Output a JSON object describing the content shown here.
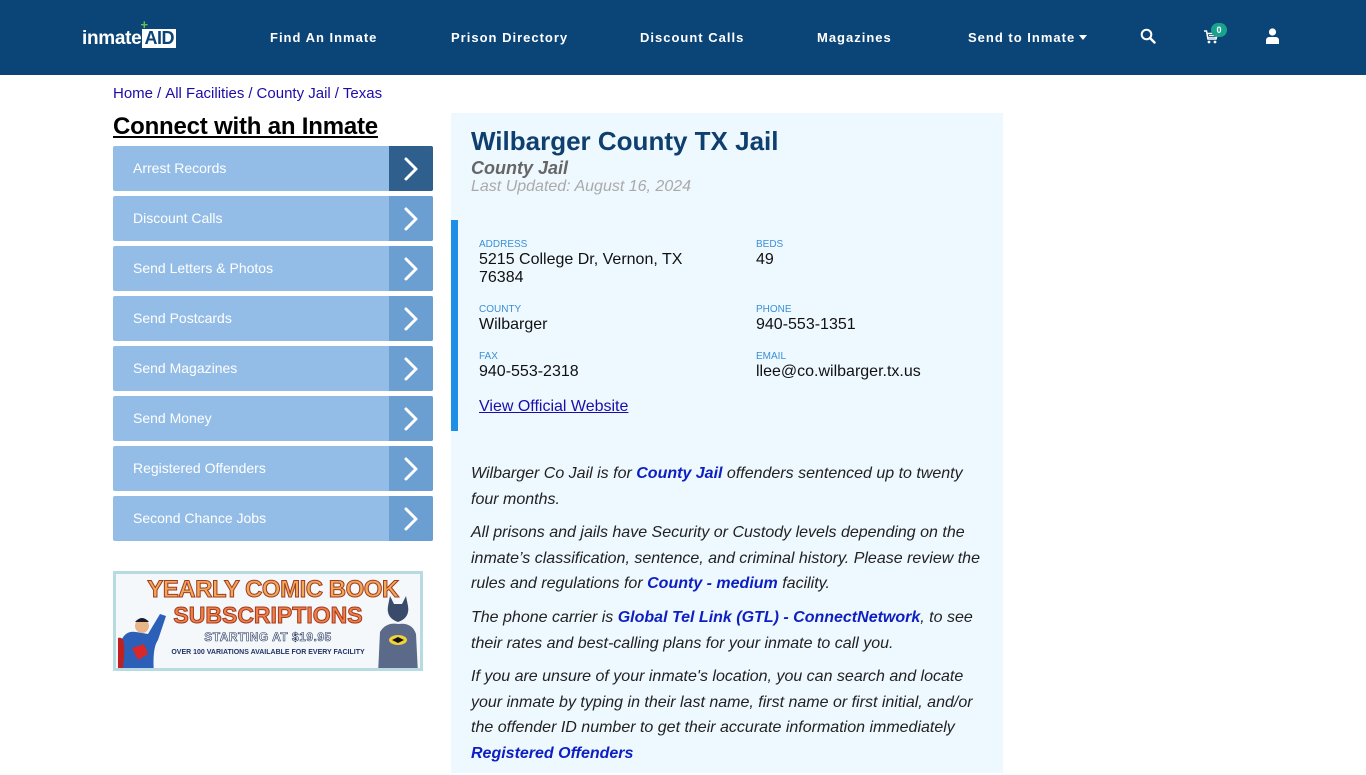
{
  "header": {
    "logo": {
      "part1": "inmate",
      "part2": "AID",
      "plus": "+"
    },
    "nav": [
      {
        "label": "Find An Inmate"
      },
      {
        "label": "Prison Directory"
      },
      {
        "label": "Discount Calls"
      },
      {
        "label": "Magazines"
      },
      {
        "label": "Send to Inmate",
        "dropdown": true
      }
    ],
    "icons": {
      "search": "search-icon",
      "cart": "cart-icon",
      "user": "user-icon"
    },
    "cart_count": "0"
  },
  "breadcrumb": [
    {
      "label": "Home"
    },
    {
      "label": "All Facilities"
    },
    {
      "label": "County Jail"
    },
    {
      "label": "Texas"
    }
  ],
  "breadcrumb_sep": "/",
  "sidebar": {
    "title": "Connect with an Inmate",
    "items": [
      {
        "label": "Arrest Records",
        "active": true
      },
      {
        "label": "Discount Calls"
      },
      {
        "label": "Send Letters & Photos"
      },
      {
        "label": "Send Postcards"
      },
      {
        "label": "Send Magazines"
      },
      {
        "label": "Send Money"
      },
      {
        "label": "Registered Offenders"
      },
      {
        "label": "Second Chance Jobs"
      }
    ],
    "ad": {
      "line1": "YEARLY COMIC BOOK",
      "line2": "SUBSCRIPTIONS",
      "line3": "STARTING AT $19.95",
      "line4": "OVER 100 VARIATIONS AVAILABLE FOR EVERY FACILITY"
    }
  },
  "facility": {
    "name": "Wilbarger County TX Jail",
    "type": "County Jail",
    "last_updated": "Last Updated: August 16, 2024",
    "fields": {
      "address": {
        "label": "Address",
        "value": "5215 College Dr, Vernon, TX 76384"
      },
      "beds": {
        "label": "Beds",
        "value": "49"
      },
      "county": {
        "label": "County",
        "value": "Wilbarger"
      },
      "phone": {
        "label": "Phone",
        "value": "940-553-1351"
      },
      "fax": {
        "label": "Fax",
        "value": "940-553-2318"
      },
      "email": {
        "label": "Email",
        "value": "llee@co.wilbarger.tx.us"
      }
    },
    "website_link": "View Official Website"
  },
  "body": {
    "p1": {
      "pre": "Wilbarger Co Jail is for ",
      "link": "County Jail",
      "post": " offenders sentenced up to twenty four months."
    },
    "p2": {
      "pre": "All prisons and jails have Security or Custody levels depending on the inmate’s classification, sentence, and criminal history. Please review the rules and regulations for ",
      "link": "County - medium",
      "post": " facility."
    },
    "p3": {
      "pre": "The phone carrier is ",
      "link": "Global Tel Link (GTL) - ConnectNetwork",
      "post": ", to see their rates and best-calling plans for your inmate to call you."
    },
    "p4": {
      "pre": "If you are unsure of your inmate's location, you can search and locate your inmate by typing in their last name, first name or first initial, and/or the offender ID number to get their accurate information immediately ",
      "link": "Registered Offenders"
    }
  },
  "colors": {
    "navbar": "#0b4477",
    "sidebar_item": "#93bde7",
    "sidebar_arrow": "#6b9fd1",
    "sidebar_arrow_active": "#2f5f8d",
    "panel_bg": "#eef8ff",
    "accent_bar": "#1e8fe6",
    "title": "#0f3f6e",
    "link": "#0d1fc2"
  }
}
